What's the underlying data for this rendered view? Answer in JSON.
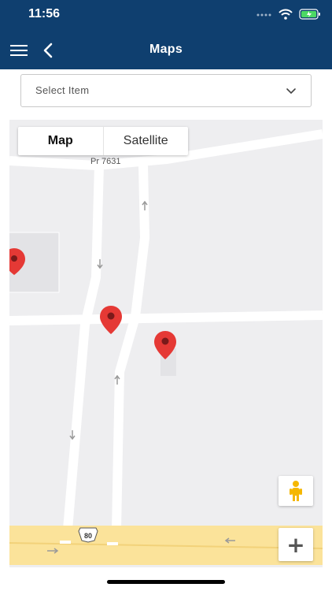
{
  "status_bar": {
    "time": "11:56"
  },
  "nav": {
    "title": "Maps"
  },
  "item_select": {
    "placeholder": "Select Item"
  },
  "map": {
    "type_controls": {
      "map_label": "Map",
      "satellite_label": "Satellite",
      "selected": "Map"
    },
    "road_labels": {
      "pr_road": "Pr 7631",
      "highway_shield": "80"
    },
    "markers": [
      "marker-partial-left",
      "marker-intersection",
      "marker-east"
    ],
    "controls": {
      "zoom_in": "+"
    }
  },
  "colors": {
    "header_bg": "#0f3f6f",
    "marker": "#e53935",
    "highway": "#fbe39a",
    "map_bg": "#eeeef0"
  }
}
